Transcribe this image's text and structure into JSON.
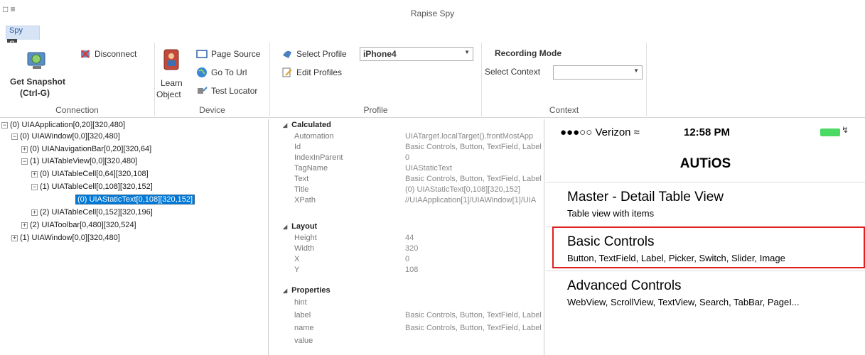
{
  "window": {
    "title": "Rapise Spy",
    "quick_access": "□ ≡"
  },
  "ribbon": {
    "tab": "Spy",
    "keytip": "S",
    "connection": {
      "label": "Connection",
      "get_snapshot": "Get Snapshot",
      "shortcut": "(Ctrl-G)",
      "disconnect": "Disconnect"
    },
    "device": {
      "label": "Device",
      "learn": "Learn",
      "object": "Object",
      "page_source": "Page Source",
      "go_to_url": "Go To Url",
      "test_locator": "Test Locator"
    },
    "profile": {
      "label": "Profile",
      "select_profile": "Select Profile",
      "profile_value": "iPhone4",
      "edit_profiles": "Edit Profiles"
    },
    "context": {
      "label": "Context",
      "recording_mode": "Recording Mode",
      "select_context": "Select Context",
      "context_value": ""
    }
  },
  "tree": [
    {
      "text": "(0) UIAApplication[0,20][320,480]",
      "expander": "−"
    },
    {
      "text": "(0) UIAWindow[0,0][320,480]",
      "expander": "−"
    },
    {
      "text": "(0) UIANavigationBar[0,20][320,64]",
      "expander": "+"
    },
    {
      "text": "(1) UIATableView[0,0][320,480]",
      "expander": "−"
    },
    {
      "text": "(0) UIATableCell[0,64][320,108]",
      "expander": "+"
    },
    {
      "text": "(1) UIATableCell[0,108][320,152]",
      "expander": "−"
    },
    {
      "text": "(0) UIAStaticText[0,108][320,152]",
      "expander": ""
    },
    {
      "text": "(2) UIATableCell[0,152][320,196]",
      "expander": "+"
    },
    {
      "text": "(2) UIAToolbar[0,480][320,524]",
      "expander": "+"
    },
    {
      "text": "(1) UIAWindow[0,0][320,480]",
      "expander": "+"
    }
  ],
  "properties": {
    "calculated": {
      "label": "Calculated",
      "rows": [
        {
          "name": "Automation",
          "value": "UIATarget.localTarget().frontMostApp"
        },
        {
          "name": "Id",
          "value": "Basic Controls, Button, TextField, Label"
        },
        {
          "name": "IndexInParent",
          "value": "0"
        },
        {
          "name": "TagName",
          "value": "UIAStaticText"
        },
        {
          "name": "Text",
          "value": "Basic Controls, Button, TextField, Label"
        },
        {
          "name": "Title",
          "value": "(0) UIAStaticText[0,108][320,152]"
        },
        {
          "name": "XPath",
          "value": "//UIAApplication[1]/UIAWindow[1]/UIA"
        }
      ]
    },
    "layout": {
      "label": "Layout",
      "rows": [
        {
          "name": "Height",
          "value": "44"
        },
        {
          "name": "Width",
          "value": "320"
        },
        {
          "name": "X",
          "value": "0"
        },
        {
          "name": "Y",
          "value": "108"
        }
      ]
    },
    "props": {
      "label": "Properties",
      "rows": [
        {
          "name": "hint",
          "value": ""
        },
        {
          "name": "label",
          "value": "Basic Controls, Button, TextField, Label"
        },
        {
          "name": "name",
          "value": "Basic Controls, Button, TextField, Label"
        },
        {
          "name": "value",
          "value": ""
        }
      ]
    }
  },
  "device": {
    "carrier": "●●●○○ Verizon ≈",
    "time": "12:58 PM",
    "nav_title": "AUTiOS",
    "cells": [
      {
        "title": "Master - Detail Table View",
        "subtitle": "Table view with items"
      },
      {
        "title": "Basic Controls",
        "subtitle": "Button, TextField, Label, Picker, Switch, Slider, Image"
      },
      {
        "title": "Advanced Controls",
        "subtitle": "WebView, ScrollView, TextView, Search, TabBar, PageI..."
      }
    ]
  }
}
